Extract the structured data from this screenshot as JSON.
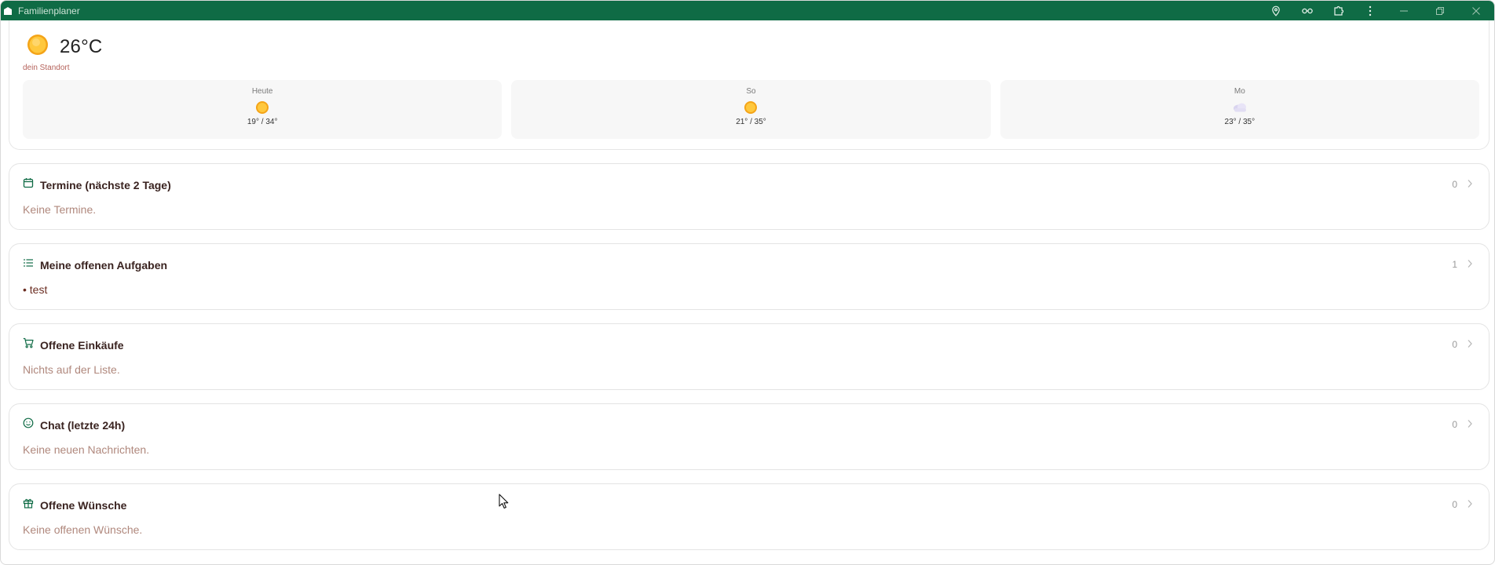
{
  "window": {
    "title": "Familienplaner"
  },
  "weather": {
    "current_temp": "26°C",
    "current_icon": "sun-icon",
    "location": "dein Standort",
    "forecast": [
      {
        "day": "Heute",
        "icon": "sun-icon",
        "temps": "19° / 34°"
      },
      {
        "day": "So",
        "icon": "sun-icon",
        "temps": "21° / 35°"
      },
      {
        "day": "Mo",
        "icon": "cloud-icon",
        "temps": "23° / 35°"
      }
    ]
  },
  "sections": [
    {
      "key": "appointments",
      "title": "Termine (nächste 2 Tage)",
      "count": "0",
      "body": "Keine Termine.",
      "icon": "calendar-icon"
    },
    {
      "key": "tasks",
      "title": "Meine offenen Aufgaben",
      "count": "1",
      "body": "• test",
      "icon": "list-icon"
    },
    {
      "key": "shopping",
      "title": "Offene Einkäufe",
      "count": "0",
      "body": "Nichts auf der Liste.",
      "icon": "cart-icon"
    },
    {
      "key": "chat",
      "title": "Chat (letzte 24h)",
      "count": "0",
      "body": "Keine neuen Nachrichten.",
      "icon": "smiley-icon"
    },
    {
      "key": "wishes",
      "title": "Offene Wünsche",
      "count": "0",
      "body": "Keine offenen Wünsche.",
      "icon": "gift-icon"
    }
  ],
  "colors": {
    "titlebar": "#0f6b45",
    "accent": "#0f6b45",
    "muted_text": "#b0887d",
    "title_text": "#3a2320"
  }
}
